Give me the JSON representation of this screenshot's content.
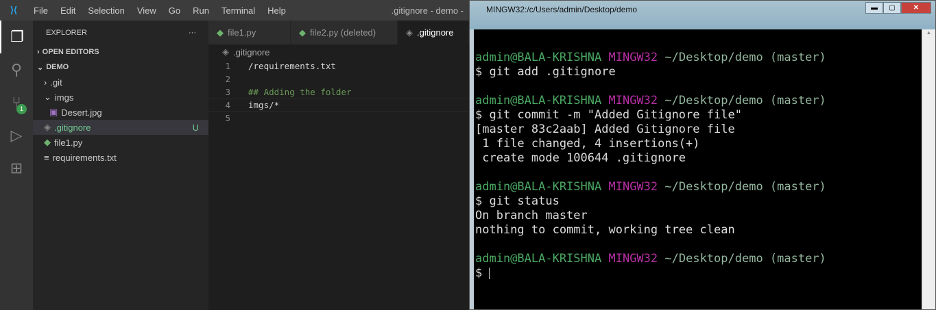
{
  "vscode": {
    "menu": [
      "File",
      "Edit",
      "Selection",
      "View",
      "Go",
      "Run",
      "Terminal",
      "Help"
    ],
    "window_title": ".gitignore - demo -",
    "scm_badge": "1",
    "explorer": {
      "title": "EXPLORER",
      "more": "···",
      "open_editors": "OPEN EDITORS",
      "folder": "DEMO",
      "items": [
        {
          "label": ".git",
          "type": "folder-collapsed"
        },
        {
          "label": "imgs",
          "type": "folder-expanded"
        },
        {
          "label": "Desert.jpg",
          "type": "image"
        },
        {
          "label": ".gitignore",
          "type": "gitignore",
          "status": "U"
        },
        {
          "label": "file1.py",
          "type": "python"
        },
        {
          "label": "requirements.txt",
          "type": "text"
        }
      ]
    },
    "tabs": [
      {
        "label": "file1.py"
      },
      {
        "label": "file2.py (deleted)"
      },
      {
        "label": ".gitignore",
        "active": true
      }
    ],
    "breadcrumb": ".gitignore",
    "lines": [
      {
        "n": "1",
        "text": "/requirements.txt"
      },
      {
        "n": "2",
        "text": ""
      },
      {
        "n": "3",
        "text": "## Adding the folder"
      },
      {
        "n": "4",
        "text": "imgs/*"
      },
      {
        "n": "5",
        "text": ""
      }
    ]
  },
  "terminal": {
    "title": "MINGW32:/c/Users/admin/Desktop/demo",
    "prompt": {
      "user": "admin@BALA-KRISHNA",
      "host": "MINGW32",
      "path": "~/Desktop/demo (master)"
    },
    "blocks": [
      {
        "cmd": "$ git add .gitignore",
        "out": []
      },
      {
        "cmd": "$ git commit -m \"Added Gitignore file\"",
        "out": [
          "[master 83c2aab] Added Gitignore file",
          " 1 file changed, 4 insertions(+)",
          " create mode 100644 .gitignore"
        ]
      },
      {
        "cmd": "$ git status",
        "out": [
          "On branch master",
          "nothing to commit, working tree clean"
        ]
      }
    ],
    "final_prompt": "$ "
  }
}
